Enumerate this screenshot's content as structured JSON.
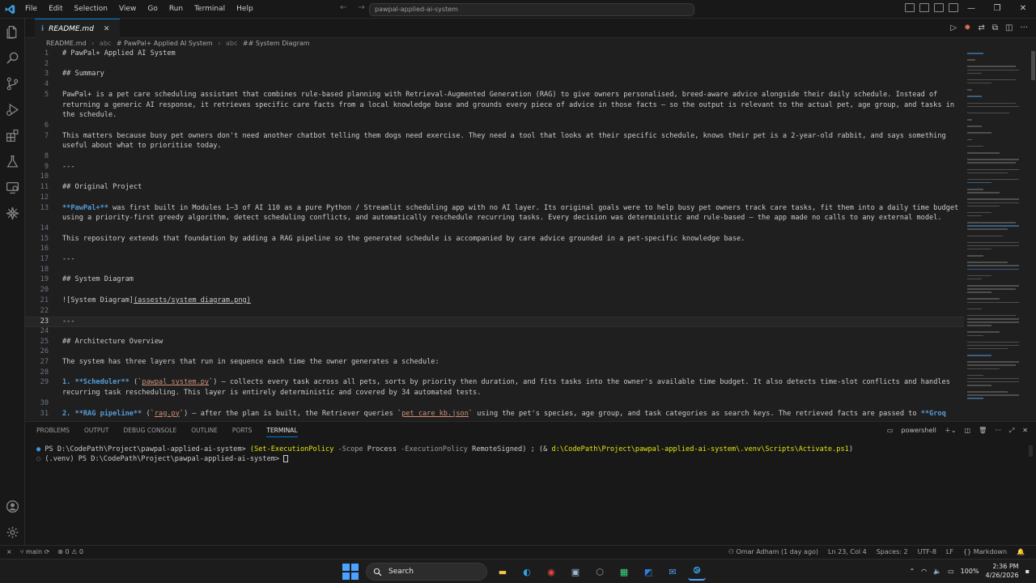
{
  "window": {
    "menu": [
      "File",
      "Edit",
      "Selection",
      "View",
      "Go",
      "Run",
      "Terminal",
      "Help"
    ],
    "search_text": "pawpal-applied-ai-system"
  },
  "tab": {
    "label": "README.md"
  },
  "breadcrumb": [
    "README.md",
    "# PawPal+ Applied AI System",
    "## System Diagram"
  ],
  "editor": {
    "lines": [
      {
        "n": "1",
        "segs": [
          {
            "t": "# PawPal+ Applied AI System",
            "c": "heading"
          }
        ]
      },
      {
        "n": "2",
        "segs": []
      },
      {
        "n": "3",
        "segs": [
          {
            "t": "## Summary",
            "c": "heading"
          }
        ]
      },
      {
        "n": "4",
        "segs": []
      },
      {
        "n": "5",
        "segs": [
          {
            "t": "PawPal+ is a pet care scheduling assistant that combines rule-based planning with Retrieval-Augmented Generation (RAG) to give owners personalised, breed-aware advice alongside their daily schedule. Instead of",
            "c": ""
          }
        ]
      },
      {
        "n": "",
        "segs": [
          {
            "t": "returning a generic AI response, it retrieves specific care facts from a local knowledge base and grounds every piece of advice in those facts — so the output is relevant to the actual pet, age group, and tasks in",
            "c": ""
          }
        ]
      },
      {
        "n": "",
        "segs": [
          {
            "t": "the schedule.",
            "c": ""
          }
        ]
      },
      {
        "n": "6",
        "segs": []
      },
      {
        "n": "7",
        "segs": [
          {
            "t": "This matters because busy pet owners don't need another chatbot telling them dogs need exercise. They need a tool that looks at their specific schedule, knows their pet is a 2-year-old rabbit, and says something",
            "c": ""
          }
        ]
      },
      {
        "n": "",
        "segs": [
          {
            "t": "useful about what to prioritise today.",
            "c": ""
          }
        ]
      },
      {
        "n": "8",
        "segs": []
      },
      {
        "n": "9",
        "segs": [
          {
            "t": "---",
            "c": "hr"
          }
        ]
      },
      {
        "n": "10",
        "segs": []
      },
      {
        "n": "11",
        "segs": [
          {
            "t": "## Original Project",
            "c": "heading"
          }
        ]
      },
      {
        "n": "12",
        "segs": []
      },
      {
        "n": "13",
        "segs": [
          {
            "t": "**PawPal+**",
            "c": "b"
          },
          {
            "t": " was first built in Modules 1–3 of AI 110 as a pure Python / Streamlit scheduling app with no AI layer. Its original goals were to help busy pet owners track care tasks, fit them into a daily time budget",
            "c": ""
          }
        ]
      },
      {
        "n": "",
        "segs": [
          {
            "t": "using a priority-first greedy algorithm, detect scheduling conflicts, and automatically reschedule recurring tasks. Every decision was deterministic and rule-based — the app made no calls to any external model.",
            "c": ""
          }
        ]
      },
      {
        "n": "14",
        "segs": []
      },
      {
        "n": "15",
        "segs": [
          {
            "t": "This repository extends that foundation by adding a RAG pipeline so the generated schedule is accompanied by care advice grounded in a pet-specific knowledge base.",
            "c": ""
          }
        ]
      },
      {
        "n": "16",
        "segs": []
      },
      {
        "n": "17",
        "segs": [
          {
            "t": "---",
            "c": "hr"
          }
        ]
      },
      {
        "n": "18",
        "segs": []
      },
      {
        "n": "19",
        "segs": [
          {
            "t": "## System Diagram",
            "c": "heading"
          }
        ]
      },
      {
        "n": "20",
        "segs": []
      },
      {
        "n": "21",
        "segs": [
          {
            "t": "![System Diagram]",
            "c": "link-text"
          },
          {
            "t": "(assests/system_diagram.png)",
            "c": "link-url"
          }
        ]
      },
      {
        "n": "22",
        "segs": []
      },
      {
        "n": "23",
        "segs": [
          {
            "t": "---",
            "c": "hr"
          }
        ],
        "current": true
      },
      {
        "n": "24",
        "segs": []
      },
      {
        "n": "25",
        "segs": [
          {
            "t": "## Architecture Overview",
            "c": "heading"
          }
        ]
      },
      {
        "n": "26",
        "segs": []
      },
      {
        "n": "27",
        "segs": [
          {
            "t": "The system has three layers that run in sequence each time the owner generates a schedule:",
            "c": ""
          }
        ]
      },
      {
        "n": "28",
        "segs": []
      },
      {
        "n": "29",
        "segs": [
          {
            "t": "1. ",
            "c": "b"
          },
          {
            "t": "**Scheduler**",
            "c": "b"
          },
          {
            "t": " (`",
            "c": ""
          },
          {
            "t": "pawpal_system.py",
            "c": "code"
          },
          {
            "t": "`) — collects every task across all pets, sorts by priority then duration, and fits tasks into the owner's available time budget. It also detects time-slot conflicts and handles",
            "c": ""
          }
        ]
      },
      {
        "n": "",
        "segs": [
          {
            "t": "recurring task rescheduling. This layer is entirely deterministic and covered by 34 automated tests.",
            "c": ""
          }
        ]
      },
      {
        "n": "30",
        "segs": []
      },
      {
        "n": "31",
        "segs": [
          {
            "t": "2. ",
            "c": "b"
          },
          {
            "t": "**RAG pipeline**",
            "c": "b"
          },
          {
            "t": " (`",
            "c": ""
          },
          {
            "t": "rag.py",
            "c": "code"
          },
          {
            "t": "`) — after the plan is built, the Retriever queries `",
            "c": ""
          },
          {
            "t": "pet_care_kb.json",
            "c": "code"
          },
          {
            "t": "` using the pet's species, age group, and task categories as search keys. The retrieved facts are passed to ",
            "c": ""
          },
          {
            "t": "**Groq",
            "c": "b"
          }
        ]
      }
    ]
  },
  "panel": {
    "tabs": [
      "PROBLEMS",
      "OUTPUT",
      "DEBUG CONSOLE",
      "OUTLINE",
      "PORTS",
      "TERMINAL"
    ],
    "active_tab": "TERMINAL",
    "shell": "powershell",
    "terminal": {
      "l1_prompt": "PS D:\\CodePath\\Project\\pawpal-applied-ai-system> ",
      "l1_a": "(Set-ExecutionPolicy",
      "l1_b": " -Scope ",
      "l1_c": "Process",
      "l1_d": " -ExecutionPolicy ",
      "l1_e": "RemoteSigned",
      "l1_f": ") ; (& ",
      "l1_g": "d:\\CodePath\\Project\\pawpal-applied-ai-system\\.venv\\Scripts\\Activate.ps1",
      "l1_h": ")",
      "l2": "(.venv) PS D:\\CodePath\\Project\\pawpal-applied-ai-system> "
    }
  },
  "status": {
    "branch": "main",
    "problems": "0",
    "warnings": "0",
    "blame": "Omar Adham (1 day ago)",
    "position": "Ln 23, Col 4",
    "spaces": "Spaces: 2",
    "encoding": "UTF-8",
    "eol": "LF",
    "language": "Markdown"
  },
  "taskbar": {
    "search": "Search",
    "battery": "100%",
    "time": "2:36 PM",
    "date": "4/26/2026"
  }
}
